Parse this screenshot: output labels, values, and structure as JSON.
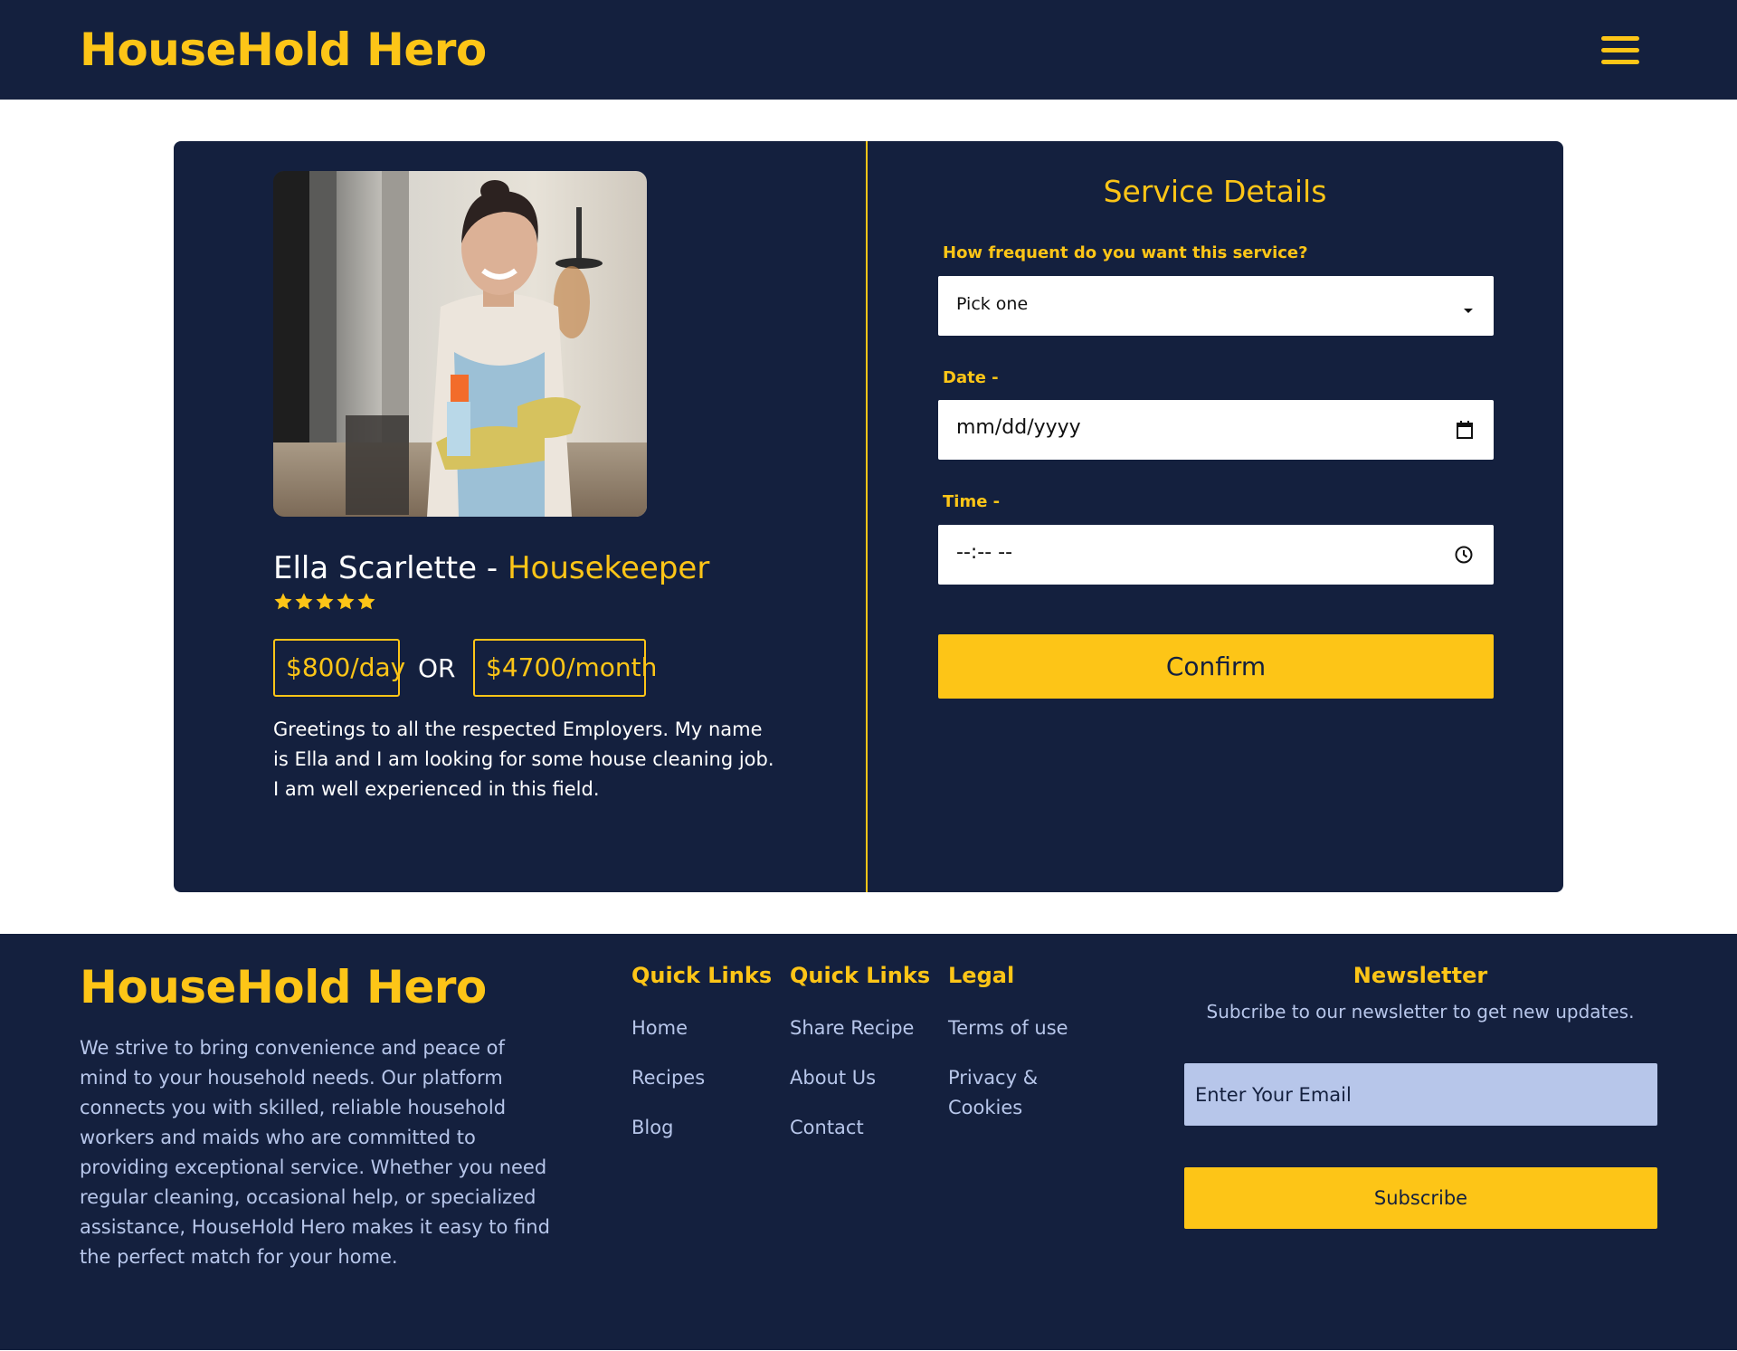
{
  "header": {
    "brand": "HouseHold Hero",
    "menu_icon": "hamburger-menu-icon"
  },
  "profile": {
    "name": "Ella Scarlette",
    "separator": " - ",
    "role": "Housekeeper",
    "rating": 5,
    "rating_max": 5,
    "price_day": "$800/day",
    "or_text": "OR",
    "price_month": "$4700/month",
    "bio": "Greetings to all the respected Employers. My name is Ella and I am looking for some house cleaning job. I am well experienced in this field."
  },
  "service_form": {
    "title": "Service Details",
    "frequency_label": "How frequent do you want this service?",
    "frequency_value": "Pick one",
    "date_label": "Date -",
    "date_value": "mm/dd/yyyy",
    "time_label": "Time -",
    "time_value": "--:-- --",
    "confirm_label": "Confirm"
  },
  "footer": {
    "brand": "HouseHold Hero",
    "about": "We strive to bring convenience and peace of mind to your household needs. Our platform connects you with skilled, reliable household workers and maids who are committed to providing exceptional service. Whether you need regular cleaning, occasional help, or specialized assistance, HouseHold Hero makes it easy to find the perfect match for your home.",
    "columns": [
      {
        "title": "Quick Links",
        "links": [
          "Home",
          "Recipes",
          "Blog"
        ]
      },
      {
        "title": "Quick Links",
        "links": [
          "Share Recipe",
          "About Us",
          "Contact"
        ]
      },
      {
        "title": "Legal",
        "links": [
          "Terms of use",
          "Privacy & Cookies"
        ]
      }
    ],
    "newsletter": {
      "title": "Newsletter",
      "subtitle": "Subcribe to our newsletter to get new updates.",
      "email_placeholder": "Enter Your Email",
      "subscribe_label": "Subscribe"
    }
  },
  "colors": {
    "navy": "#14203e",
    "accent_yellow": "#fdc517",
    "light_blue": "#b7c6ea",
    "white": "#ffffff"
  }
}
